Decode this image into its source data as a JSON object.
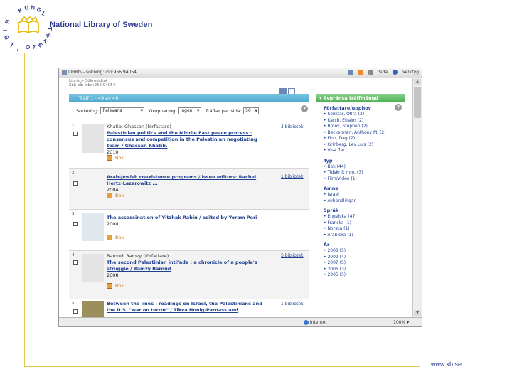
{
  "slide": {
    "brand": "National Library of Sweden",
    "logo_letters": "KUNGL BIBLIOTEKET",
    "footer_url": "www.kb.se",
    "accent_color": "#e8c84a",
    "brand_color": "#2b3a8f"
  },
  "browser": {
    "tab_title": "LIBRIS - sökning: ibn:956.94054",
    "tools": [
      "Sida",
      "Verktyg"
    ],
    "status_zone": "Internet",
    "zoom": "100%"
  },
  "page": {
    "crumb1": "Libris > Sökresultat",
    "crumb2": "Sök på: isbn:956.94054",
    "result_range": "Träff 1 - 49 av 49",
    "sort_label": "Sortering:",
    "sort_value": "Relevans",
    "group_label": "Gruppering:",
    "group_value": "Ingen",
    "per_page_label": "Träffar per sida:",
    "per_page_value": "50"
  },
  "results": [
    {
      "num": "1",
      "author": "Khatib, Ghassan (författare)",
      "title": "Palestinian politics and the Middle East peace process : consensus and competition in the Palestinian negotiating team / Ghassan Khatib.",
      "year": "2010",
      "type": "Bok",
      "holdings": "3 bibliotek"
    },
    {
      "num": "2",
      "author": "",
      "title": "Arab-Jewish coexistence programs / issue editors: Rachel Hertz-Lazarowitz ...",
      "year": "2004",
      "type": "Bok",
      "holdings": "1 bibliotek"
    },
    {
      "num": "3",
      "author": "",
      "title": "The assassination of Yitzhak Rabin / edited by Yoram Peri",
      "year": "2000",
      "type": "Bok",
      "holdings": "1 bibliotek"
    },
    {
      "num": "4",
      "author": "Baroud, Ramzy (författare)",
      "title": "The second Palestinian intifada : a chronicle of a people's struggle / Ramzy Baroud",
      "year": "2006",
      "type": "Bok",
      "holdings": "5 bibliotek"
    },
    {
      "num": "5",
      "author": "",
      "title": "Between the lines : readings on Israel, the Palestinians and the U.S. \"war on terror\" / Tikva Honig-Parnass and",
      "year": "",
      "type": "",
      "holdings": "1 bibliotek"
    }
  ],
  "facets": {
    "header": "▾ Avgränsa träffmängd",
    "groups": [
      {
        "heading": "Författare/upphov",
        "items": [
          "• Seliktar, Ofira (2)",
          "• Karsh, Efraim (2)",
          "• Brook, Stephen (2)",
          "• Beckerman, Anthony M. (2)",
          "• Finn, Dag (2)",
          "• Grinberg, Lev Luis (2)",
          "• Visa fler..."
        ]
      },
      {
        "heading": "Typ",
        "items": [
          "• Bok (44)",
          "• Tidskrift mm. (3)",
          "• Film/Video (1)"
        ]
      },
      {
        "heading": "Ämne",
        "items": [
          "• Israel",
          "• Avhandlingar"
        ]
      },
      {
        "heading": "Språk",
        "items": [
          "• Engelska (47)",
          "• Franska (1)",
          "• Norska (1)",
          "• Arabiska (1)"
        ]
      },
      {
        "heading": "År",
        "items": [
          "• 2008 (5)",
          "• 2009 (4)",
          "• 2007 (5)",
          "• 2006 (3)",
          "• 2005 (5)"
        ]
      }
    ]
  },
  "icons": [
    "logo-emblem",
    "favicon-icon",
    "home-icon",
    "rss-icon",
    "print-icon",
    "help-icon",
    "book-icon",
    "checkbox-icon",
    "list-view-icon",
    "grid-view-icon"
  ]
}
